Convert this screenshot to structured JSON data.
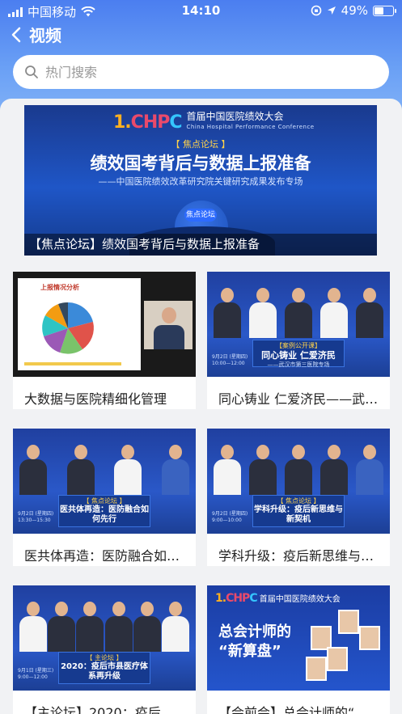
{
  "status_bar": {
    "carrier": "中国移动",
    "time": "14:10",
    "battery": "49%",
    "battery_level": 0.49
  },
  "nav": {
    "title": "视频"
  },
  "search": {
    "placeholder": "热门搜索"
  },
  "featured": {
    "logo_mark": [
      "1.",
      "CHP",
      "C"
    ],
    "logo_title": "首届中国医院绩效大会",
    "logo_subtitle": "China Hospital Performance Conference",
    "tag": "【 焦点论坛 】",
    "headline": "绩效国考背后与数据上报准备",
    "subline": "——中国医院绩效改革研究院关键研究成果发布专场",
    "badge": "焦点论坛",
    "caption": "【焦点论坛】绩效国考背后与数据上报准备"
  },
  "videos": [
    {
      "title": "大数据与医院精细化管理",
      "slide_title": "上报情况分析"
    },
    {
      "title": "同心铸业 仁爱济民——武汉市第三医院专场",
      "banner_tag": "【案例公开课】",
      "banner_title": "同心铸业 仁爱济民",
      "banner_sub": "——武汉市第三医院专场",
      "date": "9月2日 (星期四)\n10:00—12:00"
    },
    {
      "title": "医共体再造：医防融合如何先行",
      "banner_tag": "【 焦点论坛 】",
      "banner_title": "医共体再造：医防融合如何先行",
      "banner_sub": "",
      "date": "9月2日 (星期四)\n13:30—15:30"
    },
    {
      "title": "学科升级：疫后新思维与新契机",
      "banner_tag": "【 焦点论坛 】",
      "banner_title": "学科升级：疫后新思维与新契机",
      "banner_sub": "",
      "date": "9月2日 (星期四)\n9:00—10:00"
    },
    {
      "title": "【主论坛】2020：疫后市县医疗体系再升级",
      "banner_tag": "【 主论坛 】",
      "banner_title": "2020：疫后市县医疗体系再升级",
      "banner_sub": "",
      "date": "9月1日 (星期三)\n9:00—12:00"
    },
    {
      "title": "【会前会】总会计师的“新算盘”",
      "big_text": "总会计师的\n“新算盘”",
      "logo_title": "首届中国医院绩效大会"
    }
  ]
}
